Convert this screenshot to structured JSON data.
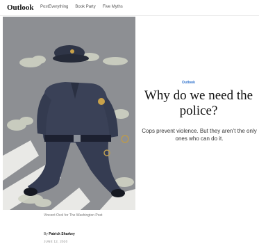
{
  "nav": {
    "brand": "Outlook",
    "links": [
      "PostEverything",
      "Book Party",
      "Five Myths"
    ]
  },
  "article": {
    "kicker": "Outlook",
    "headline": "Why do we need the police?",
    "dek": "Cops prevent violence. But they aren’t the only ones who can do it.",
    "image_credit": "Vincent Ocol for The Washington Post",
    "byline_prefix": "By",
    "author": "Patrick Sharkey",
    "date": "JUNE 12, 2020"
  },
  "colors": {
    "kicker": "#2a6ecb",
    "uniform": "#3a4157",
    "background": "#8e9094",
    "badge": "#c9a24a"
  }
}
